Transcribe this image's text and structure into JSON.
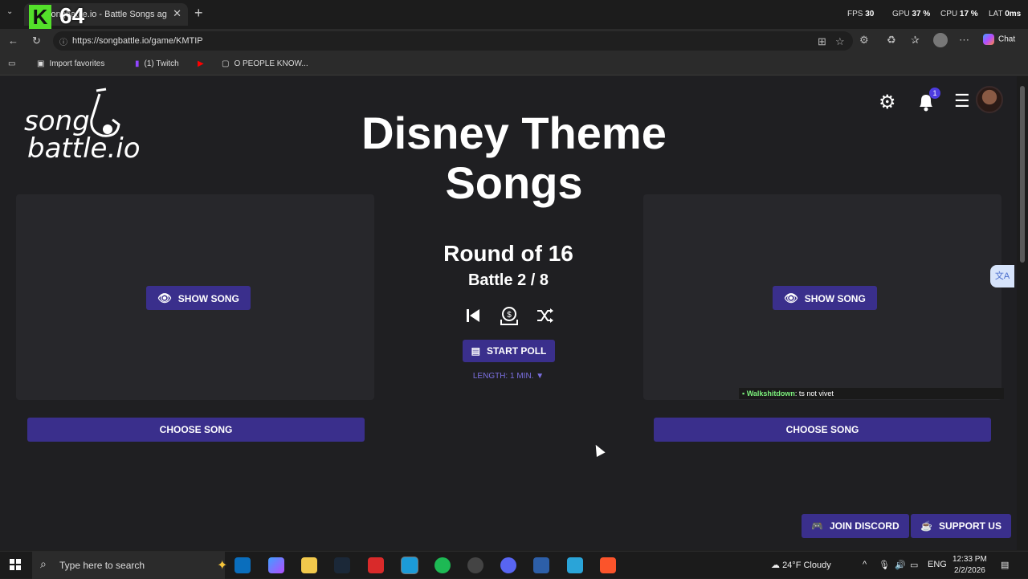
{
  "browser": {
    "tab_title": "songbattle.io - Battle Songs against",
    "overlay_k": "K",
    "overlay_number": "64",
    "perf": {
      "fps_label": "FPS",
      "fps_value": "30",
      "gpu_label": "GPU",
      "gpu_value": "37 %",
      "cpu_label": "CPU",
      "cpu_value": "17 %",
      "lat_label": "LAT",
      "lat_value": "0ms"
    },
    "url": "https://songbattle.io/game/KMTIP",
    "copilot_label": "Chat",
    "bookmarks": [
      {
        "label": "Import favorites"
      },
      {
        "label": "(1) Twitch"
      },
      {
        "label": ""
      },
      {
        "label": "O PEOPLE KNOW..."
      }
    ]
  },
  "page": {
    "logo_line1": "song",
    "logo_line2": "battle.io",
    "title": "Disney Theme Songs",
    "notification_count": "1",
    "round": "Round of 16",
    "battle": "Battle 2 / 8",
    "show_song_label": "SHOW SONG",
    "start_poll_label": "START POLL",
    "length_label": "LENGTH: 1 MIN. ▼",
    "choose_song_label": "CHOOSE SONG",
    "chat": {
      "user": "Walkshitdown",
      "message": ": ts not vivet"
    },
    "join_discord_label": "JOIN DISCORD",
    "support_us_label": "SUPPORT US",
    "accent_color": "#3a2f8c"
  },
  "taskbar": {
    "search_placeholder": "Type here to search",
    "weather": "24°F  Cloudy",
    "language": "ENG",
    "time": "12:33 PM",
    "date": "2/2/2026"
  }
}
